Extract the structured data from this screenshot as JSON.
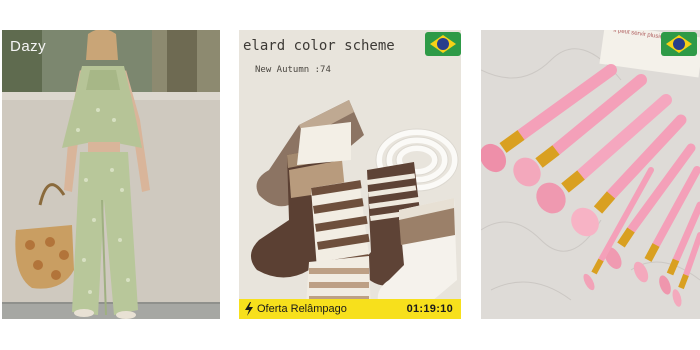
{
  "grid": {
    "cards": [
      {
        "type": "product-image",
        "subject": "outfit",
        "brand_watermark": "Dazy"
      },
      {
        "type": "product-image",
        "subject": "socks",
        "headline": "elard color scheme",
        "subline": "New Autumn :74",
        "flash_sale": {
          "label": "Oferta Relâmpago",
          "timer": "01:19:10"
        },
        "badge": "brazil-flag-icon"
      },
      {
        "type": "product-image",
        "subject": "makeup-brushes",
        "paper_text": "Il peut servir plusieurs...",
        "badge": "brazil-flag-icon"
      }
    ]
  },
  "colors": {
    "flash_bar": "#f7e01c",
    "flag_green": "#2e9a47",
    "flag_yellow": "#f7d117",
    "flag_blue": "#283e8c",
    "brush_pink": "#f4a0b9",
    "ferrule_gold": "#d9a021"
  }
}
